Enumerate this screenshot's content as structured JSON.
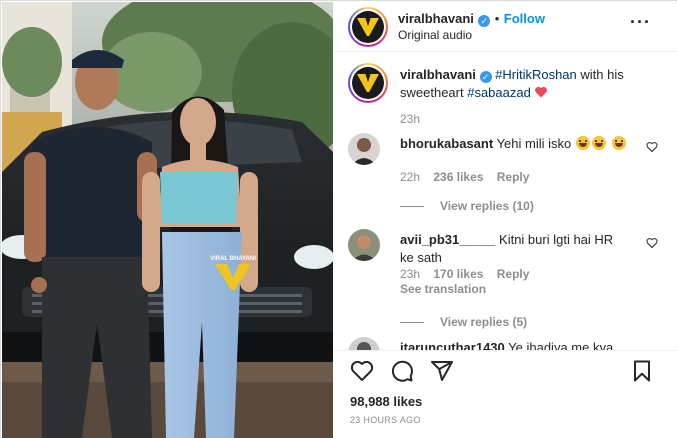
{
  "post": {
    "author": "viralbhavani",
    "follow_label": "Follow",
    "separator": "•",
    "audio": "Original audio",
    "caption": {
      "user": "viralbhavani",
      "hashtag_1": "#HritikRoshan",
      "text_mid": "with his sweetheart",
      "hashtag_2": "#sabaazad",
      "time": "23h"
    },
    "video_watermark": "VIRAL BHAYANI",
    "likes": "98,988 likes",
    "posted_ago": "23 HOURS AGO"
  },
  "comments": [
    {
      "user": "bhorukabasant",
      "text": "Yehi mili isko",
      "time": "22h",
      "likes": "236 likes",
      "reply_label": "Reply",
      "view_replies": "View replies (10)"
    },
    {
      "user": "avii_pb31_____",
      "text": "Kitni buri lgti hai HR ke sath",
      "time": "23h",
      "likes": "170 likes",
      "reply_label": "Reply",
      "see_translation": "See translation",
      "view_replies": "View replies (5)"
    },
    {
      "user": "itaruncuthar1430",
      "text": "Ye jhadiya me kya"
    }
  ],
  "icons": {
    "verified": "verified-badge-icon",
    "more": "more-options-icon",
    "like": "heart-icon",
    "comment": "comment-icon",
    "share": "share-icon",
    "save": "bookmark-icon",
    "comment_like": "heart-small-icon"
  },
  "colors": {
    "follow": "#0095f6",
    "verified": "#3897f0",
    "hashtag": "#00376b",
    "muted": "#8e8e8e",
    "emoji_heart": "#ed4956"
  }
}
